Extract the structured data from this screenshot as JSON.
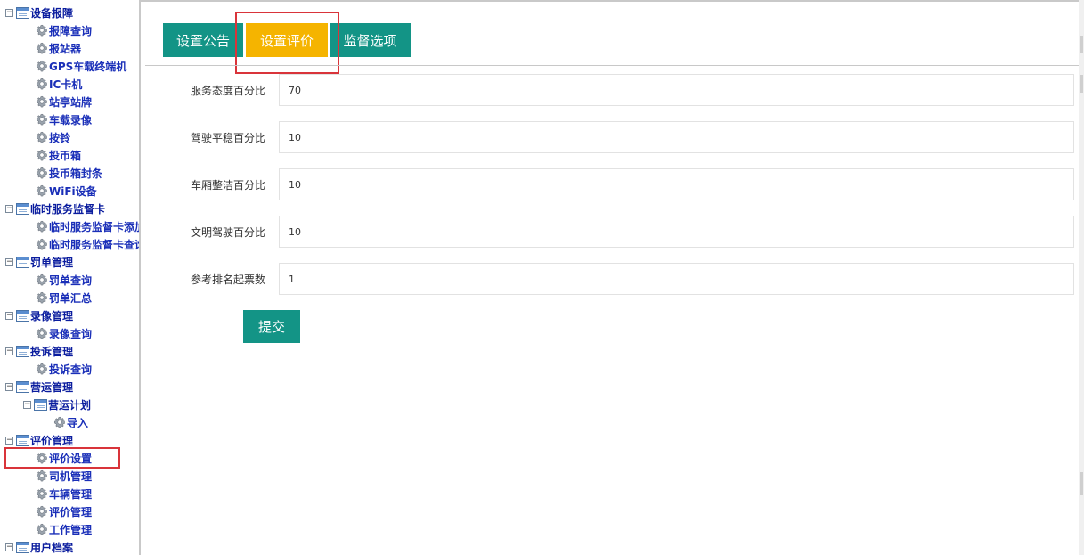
{
  "sidebar": {
    "items": [
      {
        "type": "group",
        "label": "设备报障",
        "toggle": "−"
      },
      {
        "type": "leaf",
        "label": "报障查询"
      },
      {
        "type": "leaf",
        "label": "报站器"
      },
      {
        "type": "leaf",
        "label": "GPS车载终端机"
      },
      {
        "type": "leaf",
        "label": "IC卡机"
      },
      {
        "type": "leaf",
        "label": "站亭站牌"
      },
      {
        "type": "leaf",
        "label": "车载录像"
      },
      {
        "type": "leaf",
        "label": "按铃"
      },
      {
        "type": "leaf",
        "label": "投币箱"
      },
      {
        "type": "leaf",
        "label": "投币箱封条"
      },
      {
        "type": "leaf",
        "label": "WiFi设备"
      },
      {
        "type": "group",
        "label": "临时服务监督卡",
        "toggle": "−"
      },
      {
        "type": "leaf",
        "label": "临时服务监督卡添加"
      },
      {
        "type": "leaf",
        "label": "临时服务监督卡查询"
      },
      {
        "type": "group",
        "label": "罚单管理",
        "toggle": "−"
      },
      {
        "type": "leaf",
        "label": "罚单查询"
      },
      {
        "type": "leaf",
        "label": "罚单汇总"
      },
      {
        "type": "group",
        "label": "录像管理",
        "toggle": "−"
      },
      {
        "type": "leaf",
        "label": "录像查询"
      },
      {
        "type": "group",
        "label": "投诉管理",
        "toggle": "−"
      },
      {
        "type": "leaf",
        "label": "投诉查询"
      },
      {
        "type": "group",
        "label": "营运管理",
        "toggle": "−"
      },
      {
        "type": "sub",
        "label": "营运计划",
        "toggle": "−"
      },
      {
        "type": "subleaf",
        "label": "导入"
      },
      {
        "type": "group",
        "label": "评价管理",
        "toggle": "−"
      },
      {
        "type": "leaf",
        "label": "评价设置",
        "highlighted": true
      },
      {
        "type": "leaf",
        "label": "司机管理"
      },
      {
        "type": "leaf",
        "label": "车辆管理"
      },
      {
        "type": "leaf",
        "label": "评价管理"
      },
      {
        "type": "leaf",
        "label": "工作管理"
      },
      {
        "type": "group",
        "label": "用户档案",
        "toggle": "−"
      }
    ]
  },
  "tabs": [
    {
      "label": "设置公告",
      "active": false
    },
    {
      "label": "设置评价",
      "active": true
    },
    {
      "label": "监督选项",
      "active": false
    }
  ],
  "form": {
    "fields": [
      {
        "label": "服务态度百分比",
        "value": "70"
      },
      {
        "label": "驾驶平稳百分比",
        "value": "10"
      },
      {
        "label": "车厢整洁百分比",
        "value": "10"
      },
      {
        "label": "文明驾驶百分比",
        "value": "10"
      },
      {
        "label": "参考排名起票数",
        "value": "1"
      }
    ],
    "submit_label": "提交"
  },
  "colors": {
    "tab_teal": "#139486",
    "tab_active": "#f5b400",
    "highlight_red": "#d9343a",
    "tree_text": "#0a1c9e"
  }
}
